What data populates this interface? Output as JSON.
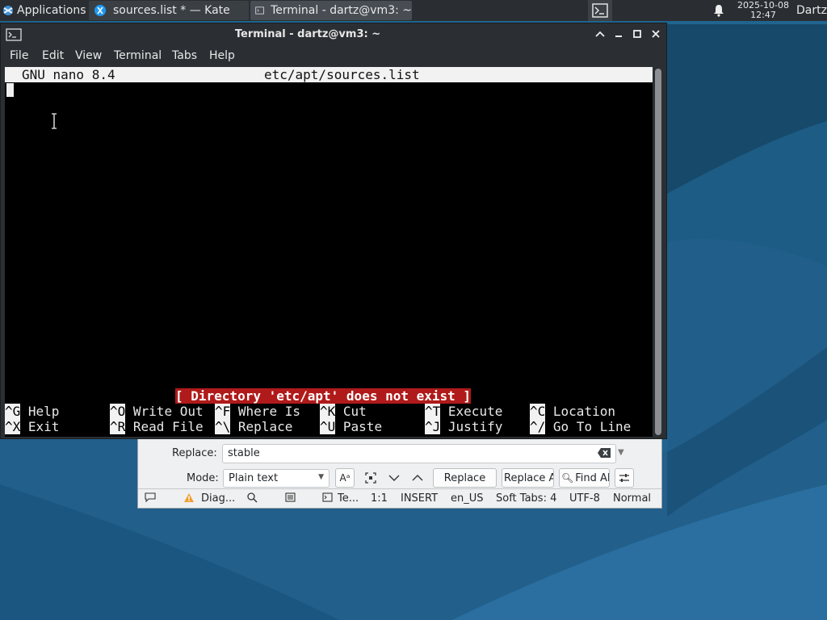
{
  "panel": {
    "apps_label": "Applications",
    "tasks": [
      {
        "label": "sources.list * — Kate"
      },
      {
        "label": "Terminal - dartz@vm3: ~"
      }
    ],
    "clock_date": "2025-10-08",
    "clock_time": "12:47",
    "user": "Dartz"
  },
  "terminal": {
    "title": "Terminal - dartz@vm3: ~",
    "menu": [
      "File",
      "Edit",
      "View",
      "Terminal",
      "Tabs",
      "Help"
    ],
    "nano_version": "GNU nano 8.4",
    "nano_filename": "etc/apt/sources.list",
    "message": "[ Directory 'etc/apt' does not exist ]",
    "shortcuts_row1": [
      {
        "key": "^G",
        "label": "Help"
      },
      {
        "key": "^O",
        "label": "Write Out"
      },
      {
        "key": "^F",
        "label": "Where Is"
      },
      {
        "key": "^K",
        "label": "Cut"
      },
      {
        "key": "^T",
        "label": "Execute"
      },
      {
        "key": "^C",
        "label": "Location"
      }
    ],
    "shortcuts_row2": [
      {
        "key": "^X",
        "label": "Exit"
      },
      {
        "key": "^R",
        "label": "Read File"
      },
      {
        "key": "^\\",
        "label": "Replace"
      },
      {
        "key": "^U",
        "label": "Paste"
      },
      {
        "key": "^J",
        "label": "Justify"
      },
      {
        "key": "^/",
        "label": "Go To Line"
      }
    ]
  },
  "kate": {
    "replace_label": "Replace:",
    "replace_value": "stable",
    "mode_label": "Mode:",
    "mode_value": "Plain text",
    "replace_button": "Replace",
    "replace_all_button": "Replace All",
    "find_all_button": "Find All",
    "status": {
      "diagnostics": "Diag...",
      "terminal": "Te...",
      "position": "1:1",
      "input_mode": "INSERT",
      "language": "en_US",
      "indent": "Soft Tabs: 4",
      "encoding": "UTF-8",
      "view_mode": "Normal"
    }
  },
  "colors": {
    "desktop": "#1e5f8a",
    "panel": "#2a2e32",
    "nano_error_bg": "#b01a1a"
  }
}
